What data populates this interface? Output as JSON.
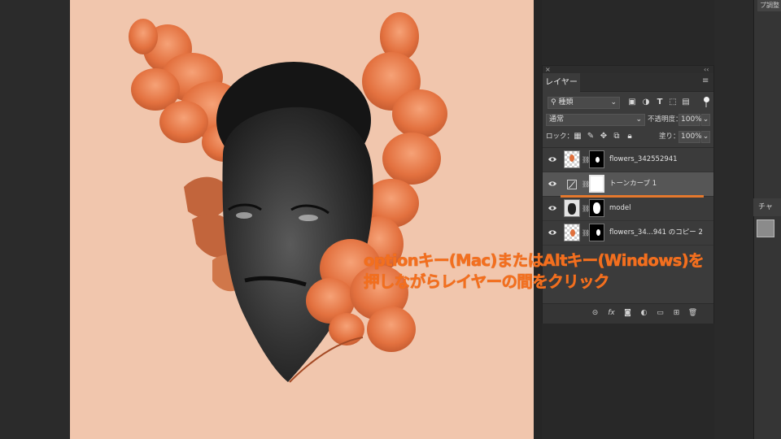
{
  "app": {
    "right_tab_label": "プ調整",
    "channels_tab_label": "チャ"
  },
  "layers_panel": {
    "tab_label": "レイヤー",
    "filter_kind": "種類",
    "blend_mode": "通常",
    "opacity_label": "不透明度：",
    "opacity_value": "100%",
    "lock_label": "ロック：",
    "fill_label": "塗り：",
    "fill_value": "100%",
    "layers": [
      {
        "name": "flowers_342552941",
        "selected": false,
        "type": "pixel-with-mask"
      },
      {
        "name": "トーンカーブ 1",
        "selected": true,
        "type": "adjustment-curves"
      },
      {
        "name": "model",
        "selected": false,
        "type": "pixel-with-mask"
      },
      {
        "name": "flowers_34...941 のコピー 2",
        "selected": false,
        "type": "pixel-with-mask"
      }
    ]
  },
  "caption": {
    "line1": "optionキー(Mac)またはAltキー(Windows)を",
    "line2": "押しながらレイヤーの間をクリック"
  },
  "colors": {
    "canvas_bg": "#f1c6ad",
    "panel_bg": "#3b3b3b",
    "caption": "#f26f1f",
    "clip_indicator": "#e5782d"
  }
}
